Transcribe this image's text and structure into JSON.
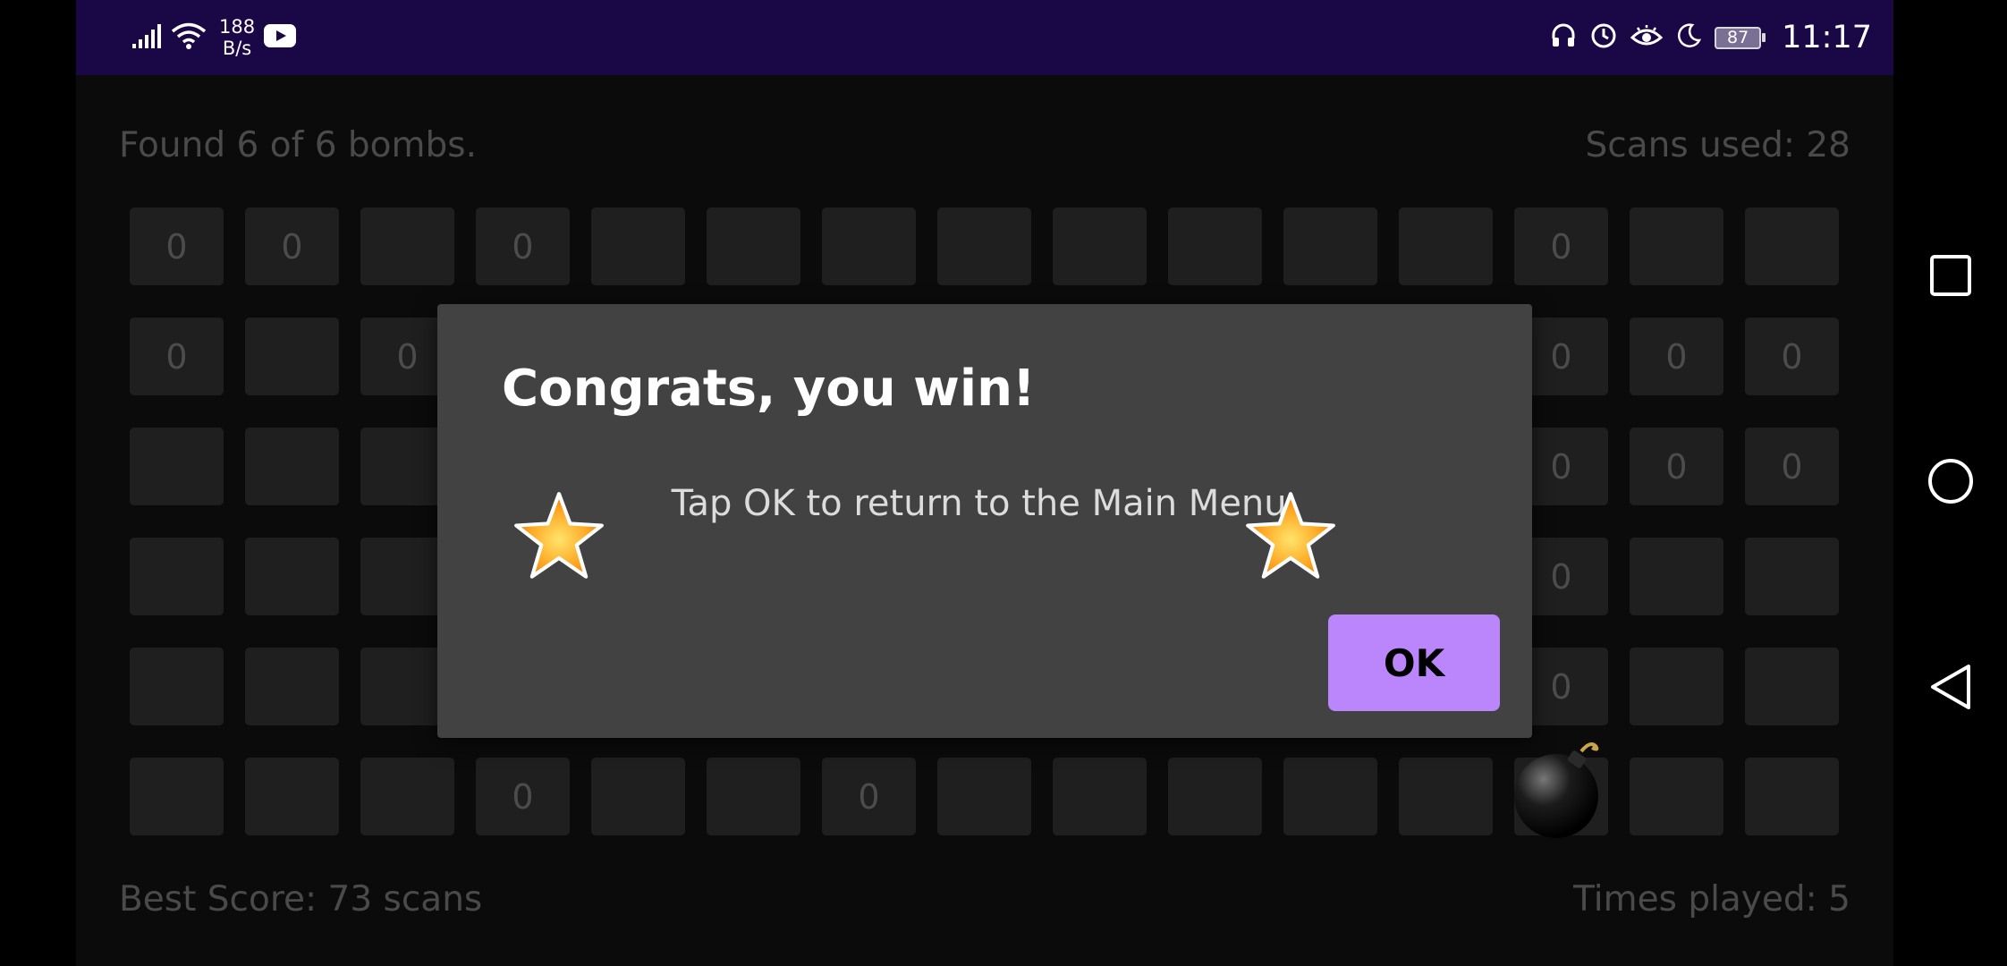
{
  "status_bar": {
    "net_speed_value": "188",
    "net_speed_unit": "B/s",
    "battery": "87",
    "time": "11:17"
  },
  "game": {
    "found_text": "Found 6 of 6 bombs.",
    "scans_text": "Scans used: 28",
    "best_score_text": "Best Score: 73 scans",
    "times_played_text": "Times played: 5"
  },
  "grid": [
    [
      "0",
      "0",
      "",
      "0",
      "",
      "",
      "",
      "",
      "",
      "",
      "",
      "",
      "0",
      "",
      ""
    ],
    [
      "0",
      "",
      "0",
      "",
      "",
      "",
      "",
      "",
      "",
      "",
      "",
      "",
      "0",
      "0",
      "0"
    ],
    [
      "",
      "",
      "",
      "",
      "",
      "",
      "",
      "",
      "",
      "",
      "",
      "",
      "0",
      "0",
      "0"
    ],
    [
      "",
      "",
      "",
      "",
      "",
      "",
      "",
      "",
      "",
      "",
      "",
      "",
      "0",
      "",
      ""
    ],
    [
      "",
      "",
      "",
      "",
      "",
      "",
      "",
      "",
      "",
      "",
      "",
      "",
      "0",
      "",
      ""
    ],
    [
      "",
      "",
      "",
      "0",
      "",
      "",
      "0",
      "",
      "",
      "",
      "",
      "",
      "",
      "",
      ""
    ]
  ],
  "dialog": {
    "title": "Congrats, you win!",
    "message": "Tap OK to return to the Main Menu.",
    "ok_label": "OK"
  },
  "colors": {
    "status_bar": "#1a0745",
    "accent": "#bb86fc",
    "dialog_bg": "#424242",
    "cell_bg": "#1f1f1f"
  }
}
